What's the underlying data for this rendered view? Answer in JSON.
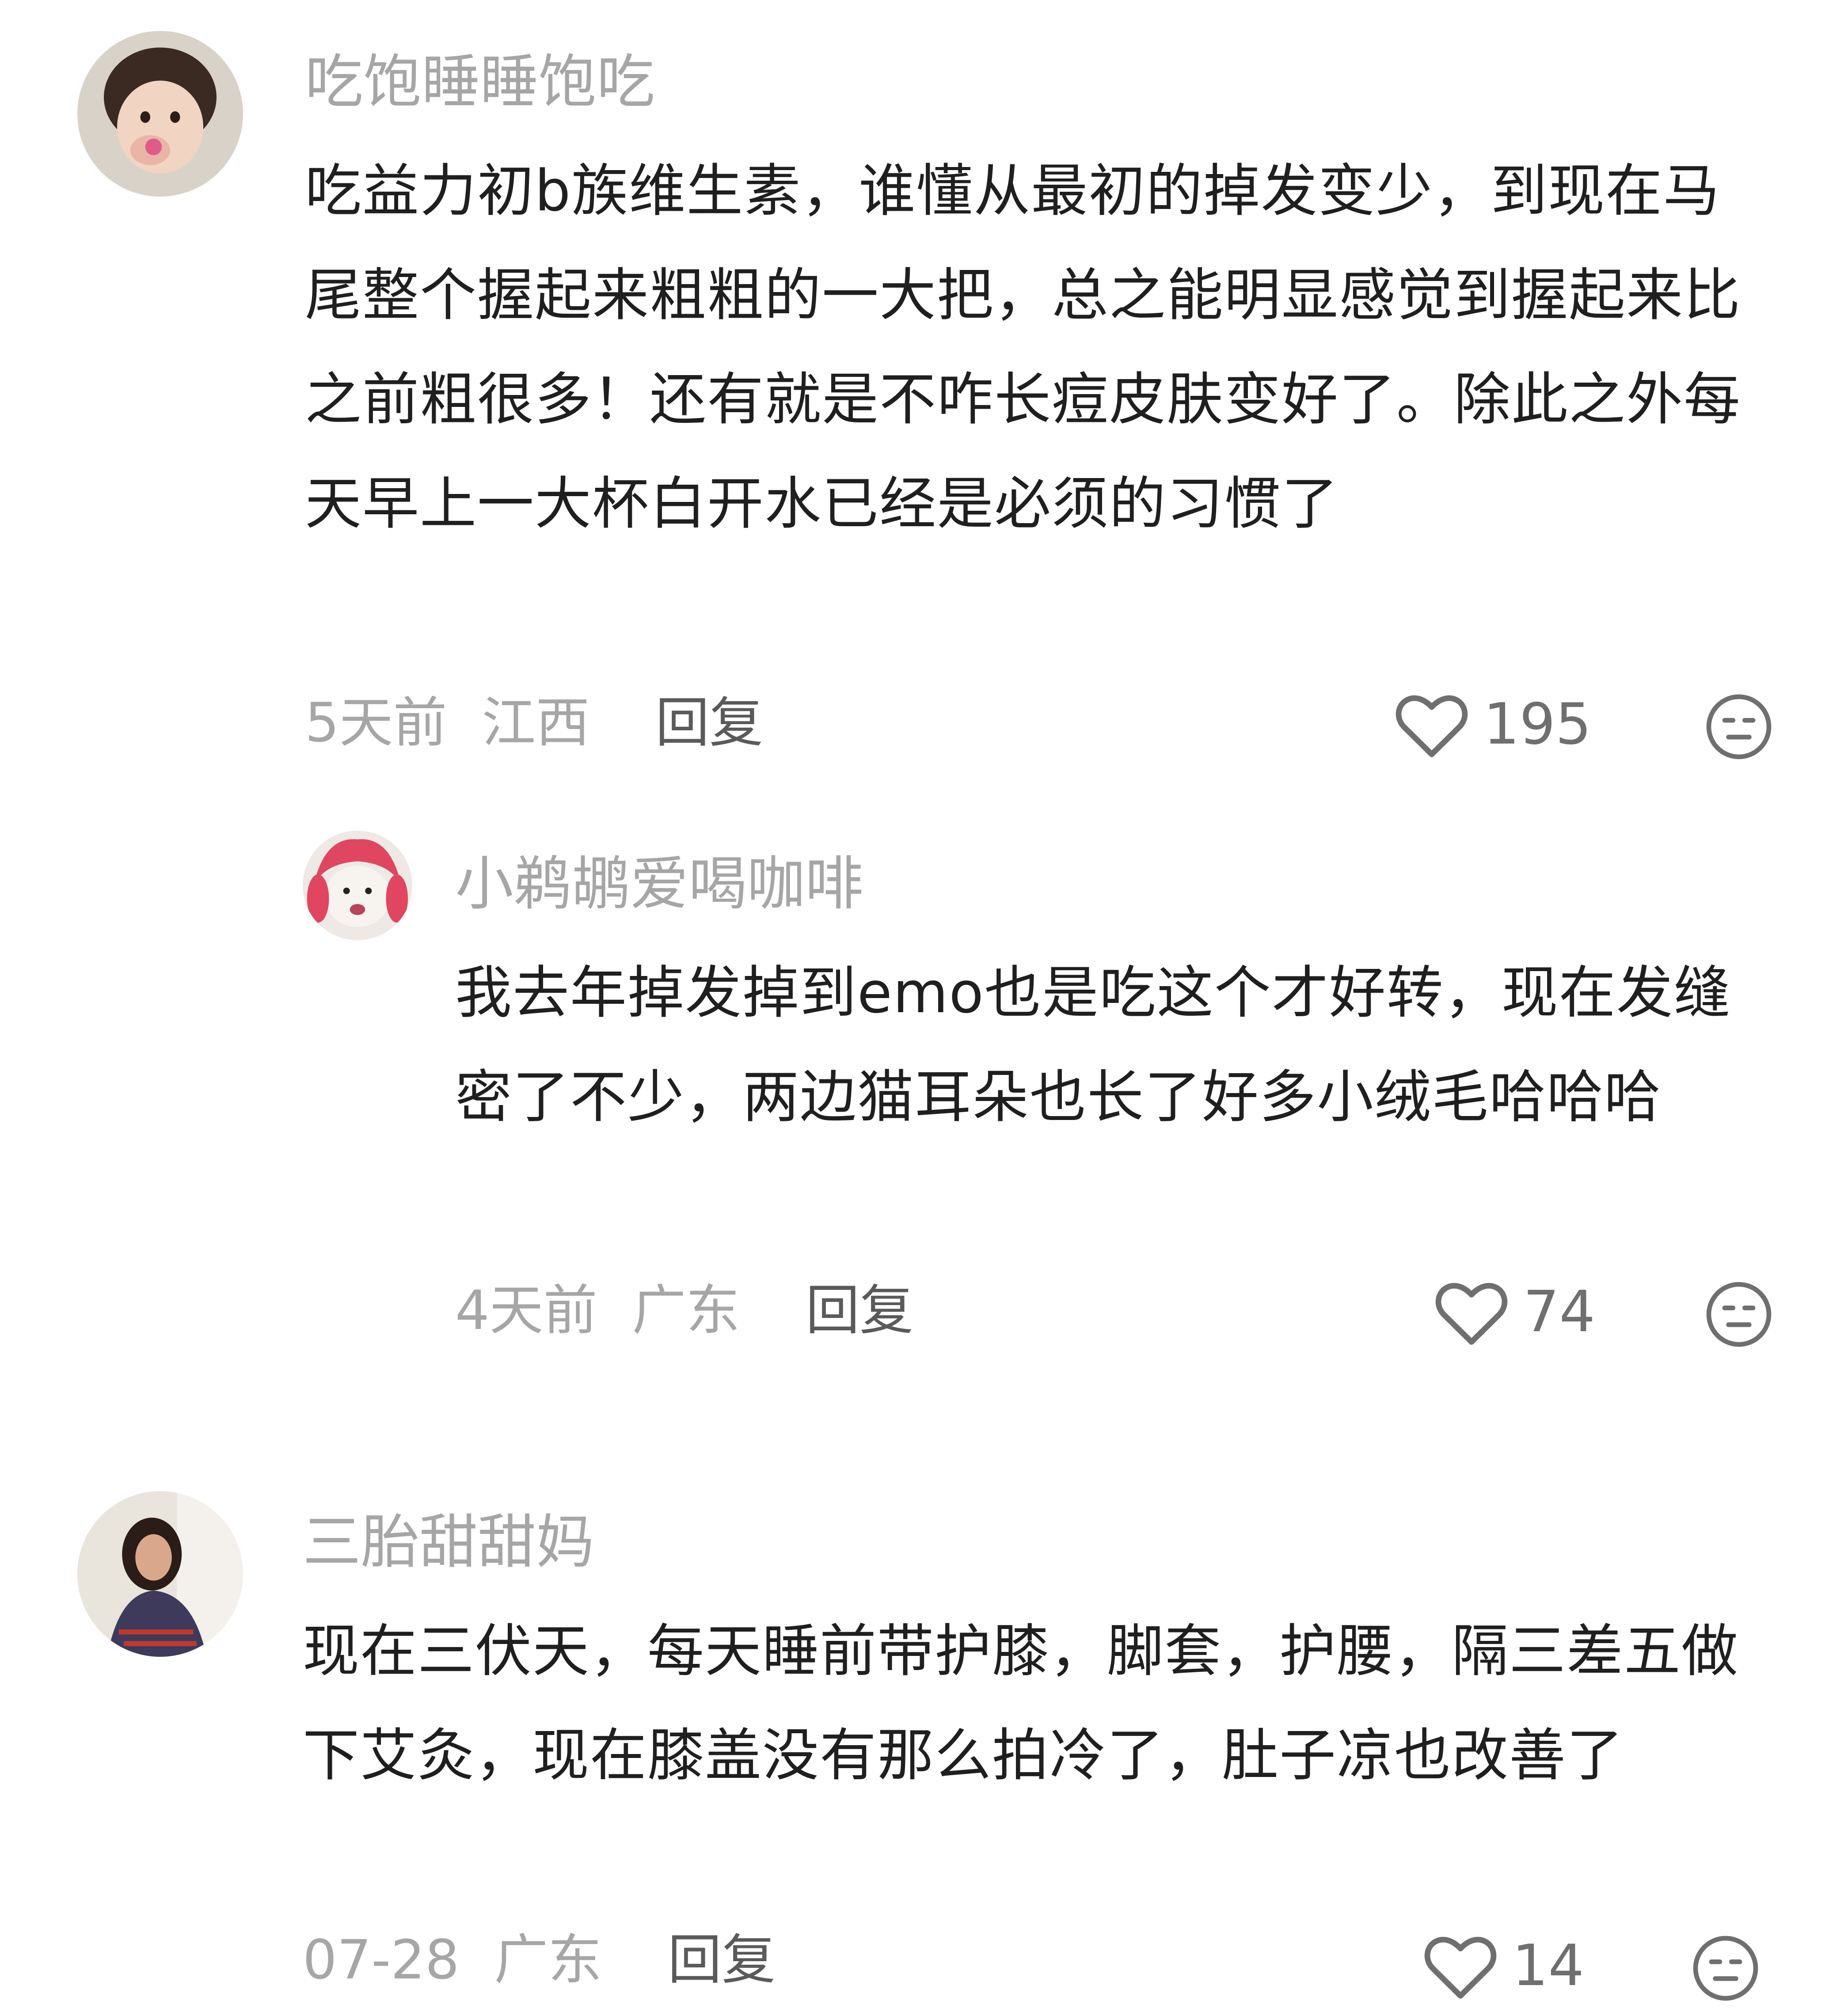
{
  "comments": [
    {
      "username": "吃饱睡睡饱吃",
      "text": "吃益力初b族维生素，谁懂从最初的掉发变少，到现在马尾整个握起来粗粗的一大把，总之能明显感觉到握起来比之前粗很多！还有就是不咋长痘皮肤变好了。除此之外每天早上一大杯白开水已经是必须的习惯了",
      "time": "5天前",
      "location": "江西",
      "reply_label": "回复",
      "likes": "195",
      "avatar_icon": "girl-photo-avatar",
      "replies": [
        {
          "username": "小鹈鹕爱喝咖啡",
          "text": "我去年掉发掉到emo也是吃这个才好转，现在发缝密了不少，两边猫耳朵也长了好多小绒毛哈哈哈",
          "time": "4天前",
          "location": "广东",
          "reply_label": "回复",
          "likes": "74",
          "avatar_icon": "cat-with-pink-wig-avatar"
        }
      ]
    },
    {
      "username": "三胎甜甜妈",
      "text": "现在三伏天，每天睡前带护膝，脚套，护腰，隔三差五做下艾灸，现在膝盖没有那么拍冷了，肚子凉也改善了",
      "time": "07-28",
      "location": "广东",
      "reply_label": "回复",
      "likes": "14",
      "avatar_icon": "woman-photo-avatar"
    }
  ],
  "icons": {
    "like": "heart-outline-icon",
    "dislike": "meh-face-icon"
  },
  "colors": {
    "username": "#a6a6a6",
    "text": "#1f1f1f",
    "meta": "#a6a6a6",
    "reply": "#5a5a5a",
    "icon": "#6f6f6f"
  }
}
